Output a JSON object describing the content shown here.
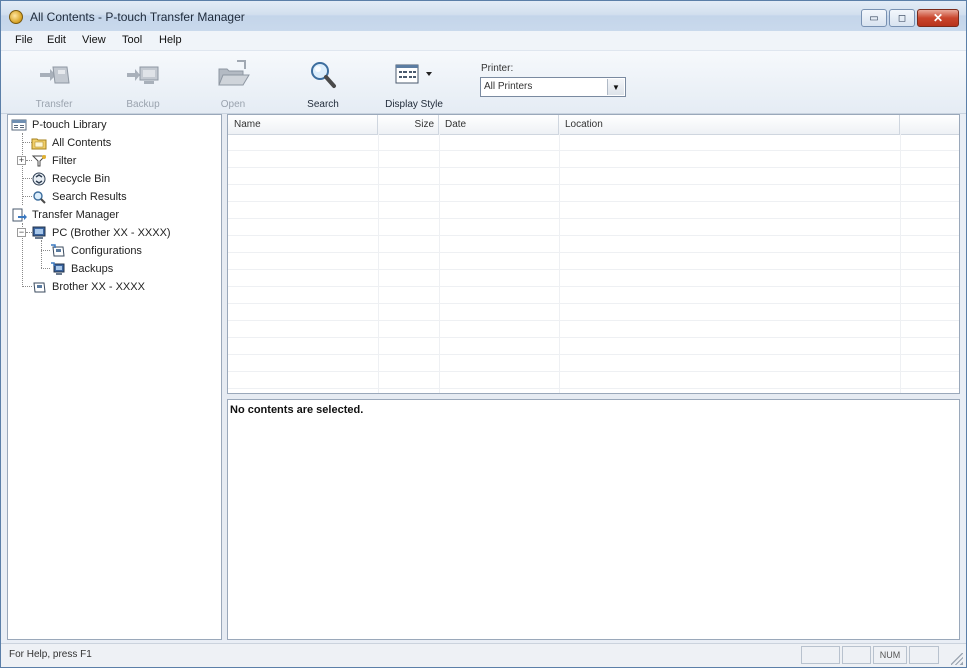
{
  "window": {
    "title": "All Contents - P-touch Transfer Manager",
    "controls": {
      "minimize": "▭",
      "maximize": "◻",
      "close": "✕"
    }
  },
  "menu": [
    "File",
    "Edit",
    "View",
    "Tool",
    "Help"
  ],
  "toolbar": {
    "transfer": "Transfer",
    "backup": "Backup",
    "open": "Open",
    "search": "Search",
    "display_style": "Display Style",
    "printer_label": "Printer:",
    "printer_value": "All Printers"
  },
  "tree": {
    "library": "P-touch Library",
    "all_contents": "All Contents",
    "filter": "Filter",
    "recycle_bin": "Recycle Bin",
    "search_results": "Search Results",
    "transfer_manager": "Transfer Manager",
    "pc": "PC (Brother XX - XXXX)",
    "configurations": "Configurations",
    "backups": "Backups",
    "device": "Brother XX - XXXX",
    "expand_symbol": "+",
    "collapse_symbol": "−"
  },
  "list": {
    "columns": [
      "Name",
      "Size",
      "Date",
      "Location"
    ]
  },
  "preview": {
    "message": "No contents are selected."
  },
  "status": {
    "help": "For Help, press F1",
    "num": "NUM"
  }
}
